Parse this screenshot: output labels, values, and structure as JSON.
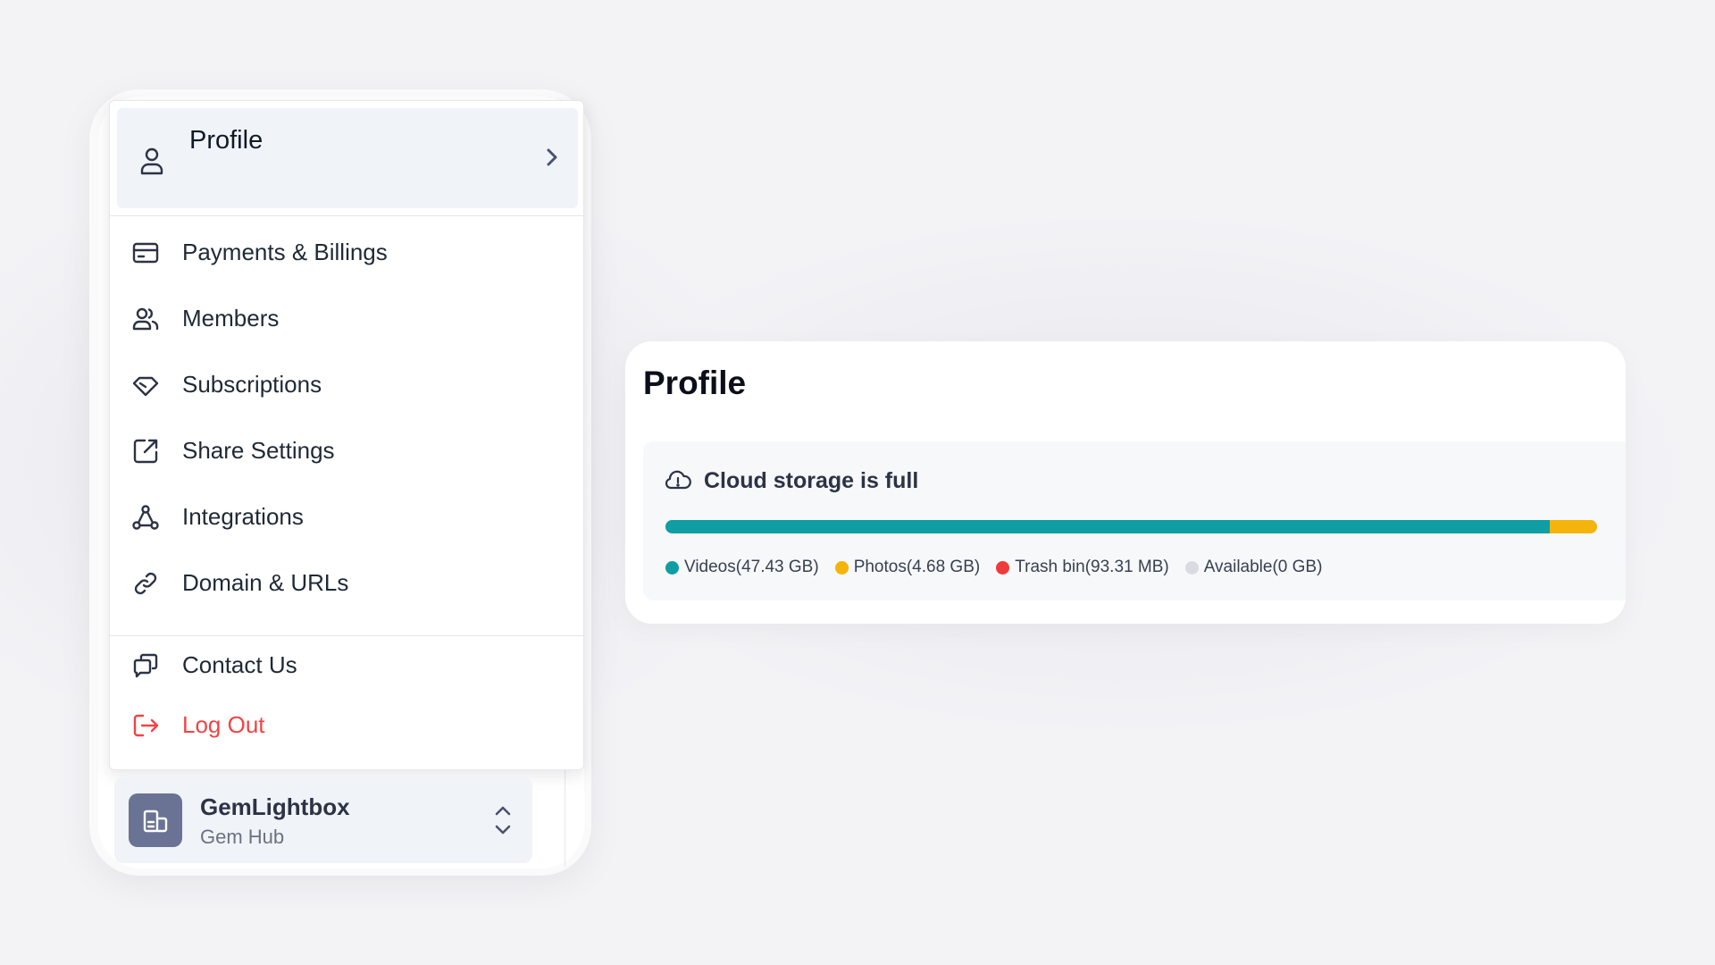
{
  "menu": {
    "profile_label": "Profile",
    "items": [
      {
        "label": "Payments & Billings",
        "icon": "credit-card-icon"
      },
      {
        "label": "Members",
        "icon": "users-icon"
      },
      {
        "label": "Subscriptions",
        "icon": "diamond-icon"
      },
      {
        "label": "Share Settings",
        "icon": "external-link-icon"
      },
      {
        "label": "Integrations",
        "icon": "integrations-icon"
      },
      {
        "label": "Domain & URLs",
        "icon": "link-icon"
      }
    ],
    "contact_label": "Contact Us",
    "logout_label": "Log Out"
  },
  "org": {
    "name": "GemLightbox",
    "subtitle": "Gem Hub"
  },
  "card": {
    "title": "Profile",
    "storage_heading": "Cloud storage is full",
    "legend": [
      {
        "label": "Videos(47.43 GB)",
        "color": "#0e9ea3"
      },
      {
        "label": "Photos(4.68 GB)",
        "color": "#f5b40b"
      },
      {
        "label": "Trash bin(93.31 MB)",
        "color": "#ef3b3b"
      },
      {
        "label": "Available(0 GB)",
        "color": "#d8dbe0"
      }
    ],
    "usage_fractions": {
      "videos": 0.949,
      "photos": 0.051,
      "trash": 0.0,
      "available": 0.0
    }
  },
  "colors": {
    "accent_teal": "#0e9ea3",
    "accent_yellow": "#f5b40b",
    "danger": "#ef4444"
  }
}
